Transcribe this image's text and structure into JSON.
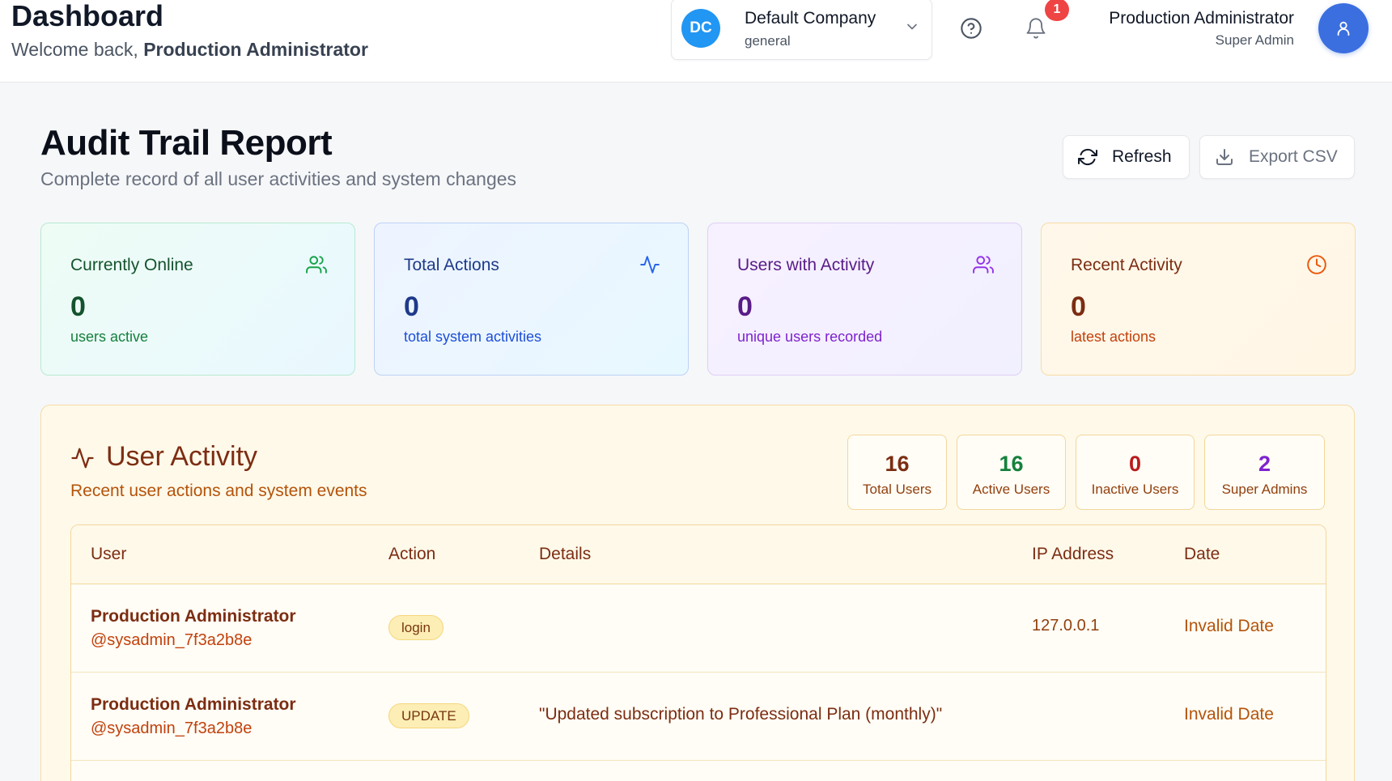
{
  "header": {
    "title": "Dashboard",
    "welcome_prefix": "Welcome back,",
    "welcome_user": "Production Administrator",
    "company": {
      "initials": "DC",
      "name": "Default Company",
      "subtitle": "general"
    },
    "notifications_count": "1",
    "user": {
      "name": "Production Administrator",
      "role": "Super Admin"
    }
  },
  "report": {
    "title": "Audit Trail Report",
    "subtitle": "Complete record of all user activities and system changes",
    "refresh_label": "Refresh",
    "export_label": "Export CSV"
  },
  "stats": [
    {
      "title": "Currently Online",
      "value": "0",
      "desc": "users active",
      "icon": "users-icon"
    },
    {
      "title": "Total Actions",
      "value": "0",
      "desc": "total system activities",
      "icon": "activity-icon"
    },
    {
      "title": "Users with Activity",
      "value": "0",
      "desc": "unique users recorded",
      "icon": "users-icon"
    },
    {
      "title": "Recent Activity",
      "value": "0",
      "desc": "latest actions",
      "icon": "clock-icon"
    }
  ],
  "activity": {
    "title": "User Activity",
    "subtitle": "Recent user actions and system events",
    "summary": [
      {
        "value": "16",
        "label": "Total Users",
        "color": "#7c2d12"
      },
      {
        "value": "16",
        "label": "Active Users",
        "color": "#15803d"
      },
      {
        "value": "0",
        "label": "Inactive Users",
        "color": "#b91c1c"
      },
      {
        "value": "2",
        "label": "Super Admins",
        "color": "#7e22ce"
      }
    ],
    "columns": [
      "User",
      "Action",
      "Details",
      "IP Address",
      "Date"
    ],
    "rows": [
      {
        "name": "Production Administrator",
        "handle": "@sysadmin_7f3a2b8e",
        "action": "login",
        "details": "",
        "ip": "127.0.0.1",
        "date": "Invalid Date"
      },
      {
        "name": "Production Administrator",
        "handle": "@sysadmin_7f3a2b8e",
        "action": "UPDATE",
        "details": "\"Updated subscription to Professional Plan (monthly)\"",
        "ip": "",
        "date": "Invalid Date"
      }
    ]
  }
}
